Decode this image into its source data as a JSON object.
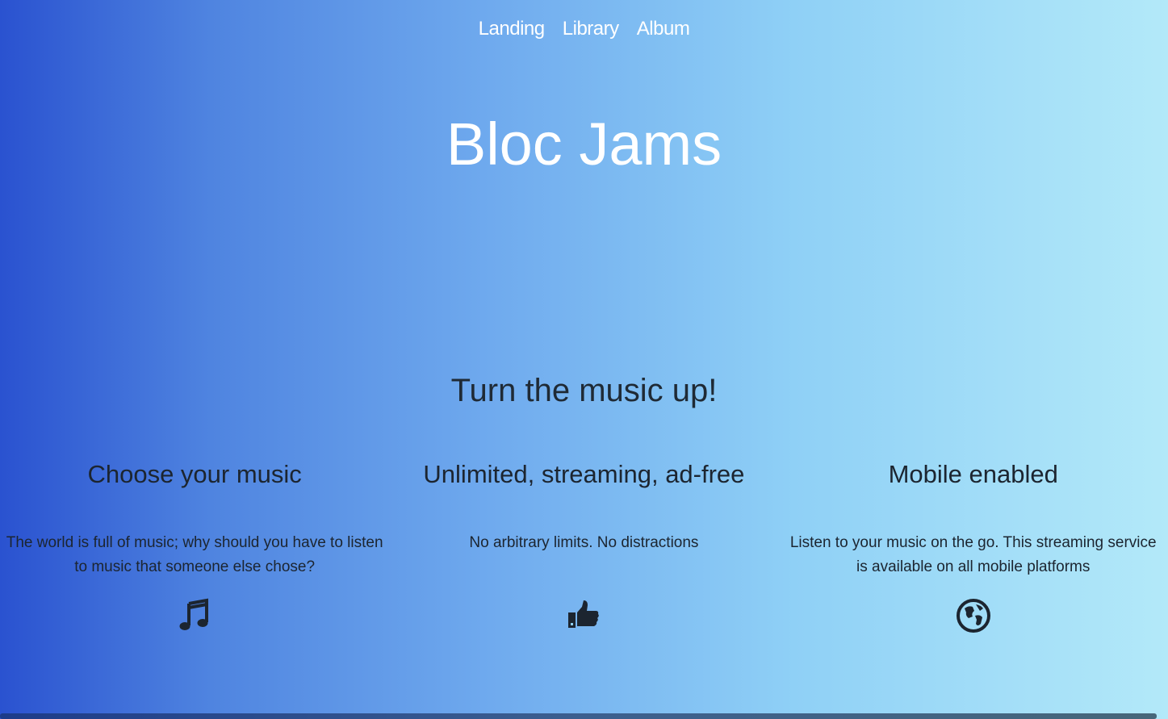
{
  "nav": {
    "links": [
      {
        "label": "Landing"
      },
      {
        "label": "Library"
      },
      {
        "label": "Album"
      }
    ]
  },
  "hero": {
    "title": "Bloc Jams"
  },
  "selling_points": {
    "tagline": "Turn the music up!",
    "items": [
      {
        "title": "Choose your music",
        "description": "The world is full of music; why should you have to listen to music that someone else chose?",
        "icon": "music-note-icon"
      },
      {
        "title": "Unlimited, streaming, ad-free",
        "description": "No arbitrary limits. No distractions",
        "icon": "thumbs-up-icon"
      },
      {
        "title": "Mobile enabled",
        "description": "Listen to your music on the go. This streaming service is available on all mobile platforms",
        "icon": "globe-icon"
      }
    ]
  },
  "colors": {
    "gradient_start": "#2a52d0",
    "gradient_end": "#b3e9f9",
    "hero_text": "#ffffff",
    "body_text": "#1c2530"
  }
}
